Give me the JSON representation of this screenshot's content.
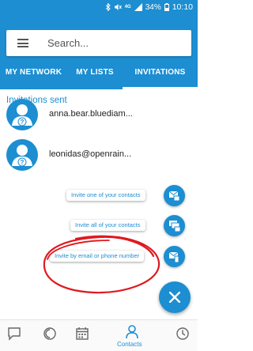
{
  "status": {
    "signal": "4G",
    "battery": "34%",
    "time": "10:10"
  },
  "search": {
    "placeholder": "Search..."
  },
  "tabs": [
    {
      "label": "MY NETWORK"
    },
    {
      "label": "MY LISTS"
    },
    {
      "label": "INVITATIONS"
    }
  ],
  "invitations": {
    "title": "Invitations sent",
    "items": [
      {
        "contact": "anna.bear.bluediam..."
      },
      {
        "contact": "leonidas@openrain..."
      }
    ]
  },
  "fab_menu": {
    "invite_contact": "Invite one of your contacts",
    "invite_all": "Invite all of your contacts",
    "invite_email_phone": "Invite by email or phone number"
  },
  "bottom_nav": {
    "active": "Contacts",
    "contacts_label": "Contacts"
  },
  "colors": {
    "primary": "#1c8ed1",
    "annotation": "#e0191f"
  }
}
